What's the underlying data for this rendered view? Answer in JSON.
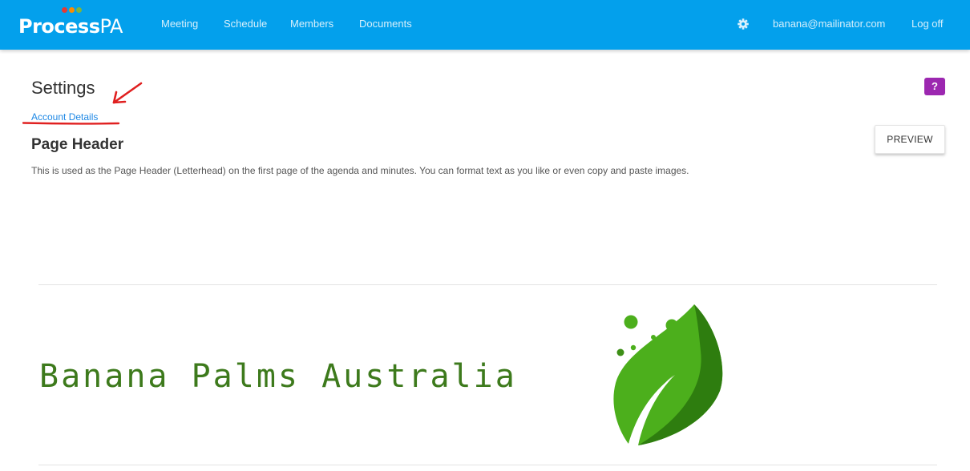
{
  "brand": {
    "name_bold": "Process",
    "name_thin": "PA",
    "dot_colors": [
      "#e53935",
      "#fb8c00",
      "#7cb342"
    ]
  },
  "nav": {
    "items": [
      {
        "label": "Meeting"
      },
      {
        "label": "Schedule"
      },
      {
        "label": "Members"
      },
      {
        "label": "Documents"
      }
    ],
    "settings_icon": "gear-icon",
    "user_email": "banana@mailinator.com",
    "logoff_label": "Log off"
  },
  "page": {
    "title": "Settings",
    "help_label": "?",
    "breadcrumb_link": "Account Details",
    "section_title": "Page Header",
    "preview_label": "PREVIEW",
    "description": "This is used as the Page Header (Letterhead) on the first page of the agenda and minutes. You can format text as you like or even copy and paste images."
  },
  "letterhead": {
    "company_name": "Banana Palms Australia",
    "logo_icon": "leaf-icon"
  },
  "colors": {
    "navbar": "#03a0ec",
    "help_button": "#9c27b0",
    "link": "#1e88e5",
    "company_text": "#3d7a1c",
    "leaf_light": "#4caf1c",
    "leaf_dark": "#2e7d0f",
    "annotation": "#e02020"
  }
}
